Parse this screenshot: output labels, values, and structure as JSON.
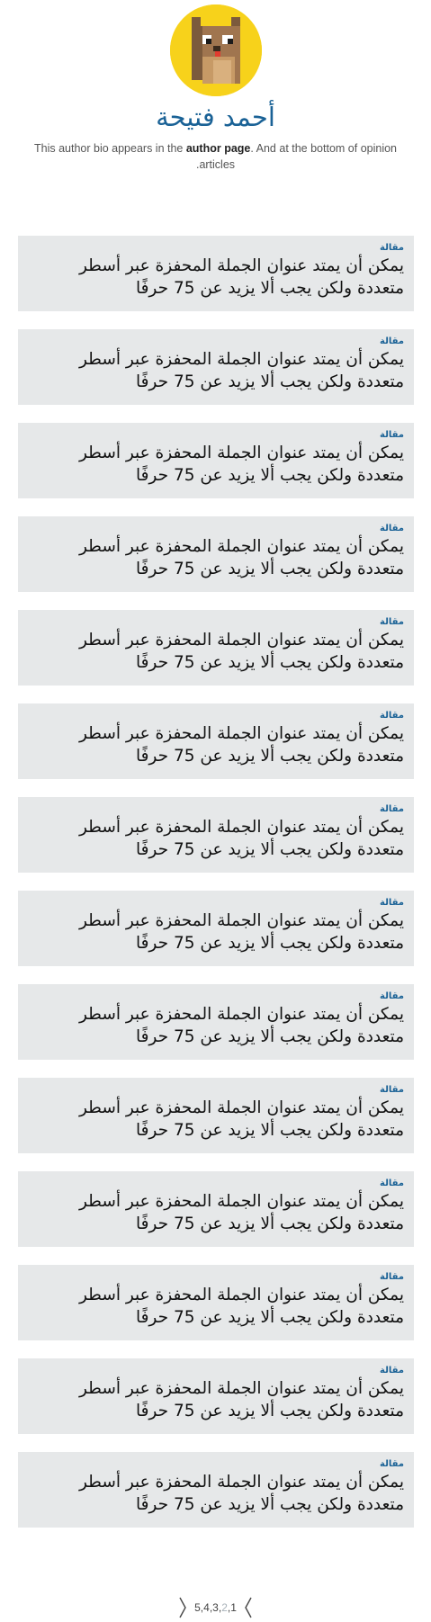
{
  "author": {
    "avatar_icon": "pixel-cat-avatar-icon",
    "avatar_bg_color": "#f7d21b",
    "name": "أحمد فتيحة",
    "bio_prefix": "This author bio appears in the ",
    "bio_bold": "author page",
    "bio_suffix": ". And at the bottom of opinion articles."
  },
  "articles": [
    {
      "kicker": "مقالة",
      "title": "يمكن أن يمتد عنوان الجملة المحفزة عبر أسطر متعددة ولكن يجب ألا يزيد عن 75 حرفًا"
    },
    {
      "kicker": "مقالة",
      "title": "يمكن أن يمتد عنوان الجملة المحفزة عبر أسطر متعددة ولكن يجب ألا يزيد عن 75 حرفًا"
    },
    {
      "kicker": "مقالة",
      "title": "يمكن أن يمتد عنوان الجملة المحفزة عبر أسطر متعددة ولكن يجب ألا يزيد عن 75 حرفًا"
    },
    {
      "kicker": "مقالة",
      "title": "يمكن أن يمتد عنوان الجملة المحفزة عبر أسطر متعددة ولكن يجب ألا يزيد عن 75 حرفًا"
    },
    {
      "kicker": "مقالة",
      "title": "يمكن أن يمتد عنوان الجملة المحفزة عبر أسطر متعددة ولكن يجب ألا يزيد عن 75 حرفًا"
    },
    {
      "kicker": "مقالة",
      "title": "يمكن أن يمتد عنوان الجملة المحفزة عبر أسطر متعددة ولكن يجب ألا يزيد عن 75 حرفًا"
    },
    {
      "kicker": "مقالة",
      "title": "يمكن أن يمتد عنوان الجملة المحفزة عبر أسطر متعددة ولكن يجب ألا يزيد عن 75 حرفًا"
    },
    {
      "kicker": "مقالة",
      "title": "يمكن أن يمتد عنوان الجملة المحفزة عبر أسطر متعددة ولكن يجب ألا يزيد عن 75 حرفًا"
    },
    {
      "kicker": "مقالة",
      "title": "يمكن أن يمتد عنوان الجملة المحفزة عبر أسطر متعددة ولكن يجب ألا يزيد عن 75 حرفًا"
    },
    {
      "kicker": "مقالة",
      "title": "يمكن أن يمتد عنوان الجملة المحفزة عبر أسطر متعددة ولكن يجب ألا يزيد عن 75 حرفًا"
    },
    {
      "kicker": "مقالة",
      "title": "يمكن أن يمتد عنوان الجملة المحفزة عبر أسطر متعددة ولكن يجب ألا يزيد عن 75 حرفًا"
    },
    {
      "kicker": "مقالة",
      "title": "يمكن أن يمتد عنوان الجملة المحفزة عبر أسطر متعددة ولكن يجب ألا يزيد عن 75 حرفًا"
    },
    {
      "kicker": "مقالة",
      "title": "يمكن أن يمتد عنوان الجملة المحفزة عبر أسطر متعددة ولكن يجب ألا يزيد عن 75 حرفًا"
    },
    {
      "kicker": "مقالة",
      "title": "يمكن أن يمتد عنوان الجملة المحفزة عبر أسطر متعددة ولكن يجب ألا يزيد عن 75 حرفًا"
    }
  ],
  "pagination": {
    "prev_icon": "chevron-left-icon",
    "next_icon": "chevron-right-icon",
    "pages": [
      "5",
      "4",
      "3",
      "2",
      "1"
    ],
    "current": "2"
  },
  "colors": {
    "accent": "#1a6296",
    "card_bg": "#e6e8e9",
    "current_page": "#a9b3ba"
  }
}
